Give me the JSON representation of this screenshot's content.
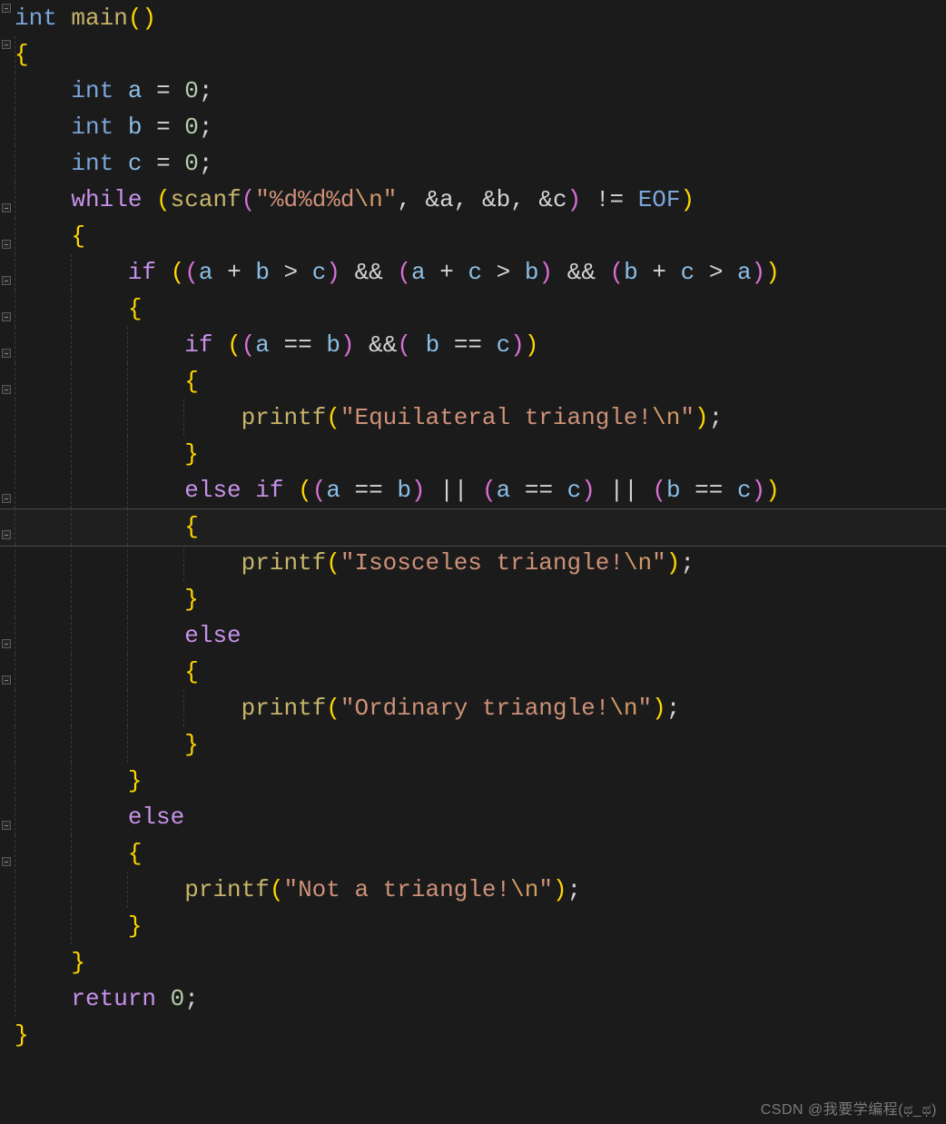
{
  "watermark": "CSDN @我要学编程(ಥ_ಥ)",
  "code": {
    "t1_int": "int",
    "t1_main": "main",
    "t1_lp": "(",
    "t1_rp": ")",
    "t2_lb": "{",
    "t3_int": "int",
    "t3_a": "a",
    "t3_eq": "=",
    "t3_z": "0",
    "t3_sc": ";",
    "t4_int": "int",
    "t4_b": "b",
    "t4_eq": "=",
    "t4_z": "0",
    "t4_sc": ";",
    "t5_int": "int",
    "t5_c": "c",
    "t5_eq": "=",
    "t5_z": "0",
    "t5_sc": ";",
    "t6_while": "while",
    "t6_lp1": "(",
    "t6_scanf": "scanf",
    "t6_lp2": "(",
    "t6_fmt": "\"%d%d%d",
    "t6_esc": "\\n",
    "t6_fmt2": "\"",
    "t6_c1": ",",
    "t6_amp_a": "&a",
    "t6_c2": ",",
    "t6_amp_b": "&b",
    "t6_c3": ",",
    "t6_amp_c": "&c",
    "t6_rp2": ")",
    "t6_ne": "!=",
    "t6_eof": "EOF",
    "t6_rp1": ")",
    "t7_lb": "{",
    "t8_if": "if",
    "t8_lp1": "(",
    "t8_lp2": "(",
    "t8_a": "a",
    "t8_plus1": "+",
    "t8_b": "b",
    "t8_gt1": ">",
    "t8_c": "c",
    "t8_rp2": ")",
    "t8_and1": "&&",
    "t8_lp3": "(",
    "t8_a2": "a",
    "t8_plus2": "+",
    "t8_c2": "c",
    "t8_gt2": ">",
    "t8_b2": "b",
    "t8_rp3": ")",
    "t8_and2": "&&",
    "t8_lp4": "(",
    "t8_b3": "b",
    "t8_plus3": "+",
    "t8_c3": "c",
    "t8_gt3": ">",
    "t8_a3": "a",
    "t8_rp4": ")",
    "t8_rp1": ")",
    "t9_lb": "{",
    "t10_if": "if",
    "t10_lp1": "(",
    "t10_lp2": "(",
    "t10_a": "a",
    "t10_eq1": "==",
    "t10_b": "b",
    "t10_rp2": ")",
    "t10_and": "&&",
    "t10_lp3": "(",
    "t10_b2": "b",
    "t10_eq2": "==",
    "t10_c": "c",
    "t10_rp3": ")",
    "t10_rp1": ")",
    "t11_lb": "{",
    "t12_printf": "printf",
    "t12_lp": "(",
    "t12_s1": "\"Equilateral triangle!",
    "t12_esc": "\\n",
    "t12_s2": "\"",
    "t12_rp": ")",
    "t12_sc": ";",
    "t13_rb": "}",
    "t14_else": "else",
    "t14_if": "if",
    "t14_lp1": "(",
    "t14_lp2": "(",
    "t14_a": "a",
    "t14_eq1": "==",
    "t14_b": "b",
    "t14_rp2": ")",
    "t14_or1": "||",
    "t14_lp3": "(",
    "t14_a2": "a",
    "t14_eq2": "==",
    "t14_c": "c",
    "t14_rp3": ")",
    "t14_or2": "||",
    "t14_lp4": "(",
    "t14_b2": "b",
    "t14_eq3": "==",
    "t14_c2": "c",
    "t14_rp4": ")",
    "t14_rp1": ")",
    "t15_lb": "{",
    "t16_printf": "printf",
    "t16_lp": "(",
    "t16_s1": "\"Isosceles triangle!",
    "t16_esc": "\\n",
    "t16_s2": "\"",
    "t16_rp": ")",
    "t16_sc": ";",
    "t17_rb": "}",
    "t18_else": "else",
    "t19_lb": "{",
    "t20_printf": "printf",
    "t20_lp": "(",
    "t20_s1": "\"Ordinary triangle!",
    "t20_esc": "\\n",
    "t20_s2": "\"",
    "t20_rp": ")",
    "t20_sc": ";",
    "t21_rb": "}",
    "t22_rb": "}",
    "t23_else": "else",
    "t24_lb": "{",
    "t25_printf": "printf",
    "t25_lp": "(",
    "t25_s1": "\"Not a triangle!",
    "t25_esc": "\\n",
    "t25_s2": "\"",
    "t25_rp": ")",
    "t25_sc": ";",
    "t26_rb": "}",
    "t27_rb": "}",
    "t28_return": "return",
    "t28_z": "0",
    "t28_sc": ";",
    "t29_rb": "}"
  }
}
